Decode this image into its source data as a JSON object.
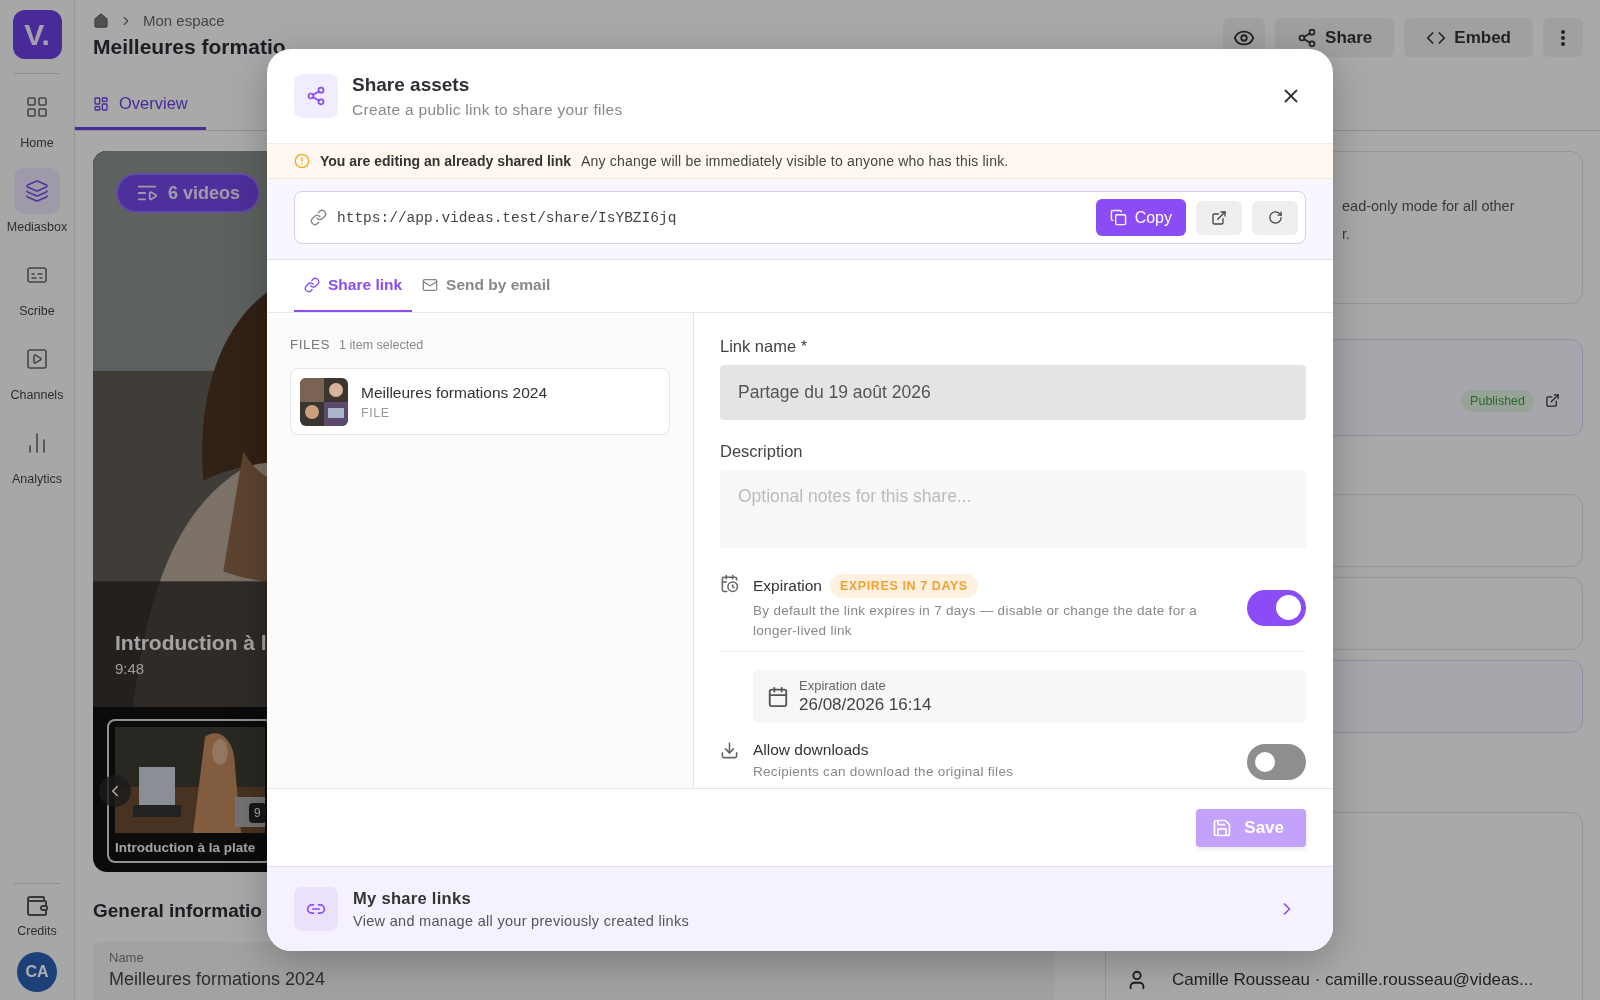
{
  "sidebar": {
    "logo": "V.",
    "items": [
      {
        "label": "Home",
        "kind": "home",
        "selected": false
      },
      {
        "label": "Mediasbox",
        "kind": "media",
        "selected": true
      },
      {
        "label": "Scribe",
        "kind": "scribe",
        "selected": false
      },
      {
        "label": "Channels",
        "kind": "channels",
        "selected": false
      },
      {
        "label": "Analytics",
        "kind": "analytics",
        "selected": false
      }
    ],
    "footer": {
      "label": "Credits"
    },
    "avatar": "CA"
  },
  "header": {
    "breadcrumb": "Mon espace",
    "title": "Meilleures formatio",
    "actions": [
      {
        "kind": "preview"
      },
      {
        "kind": "share",
        "label": "Share"
      },
      {
        "kind": "embed",
        "label": "Embed"
      },
      {
        "kind": "more"
      }
    ]
  },
  "tabs": [
    {
      "label": "Overview",
      "selected": true
    }
  ],
  "video_card": {
    "badge": "6 videos",
    "title": "Introduction à l",
    "duration": "9:48",
    "thumbnail": {
      "title": "Introduction à la plate",
      "duration": "9"
    }
  },
  "general_info": {
    "heading": "General informatio",
    "name_label": "Name",
    "name_value": "Meilleures formations 2024"
  },
  "details_panel": {
    "notice_lines": [
      "ead-only mode for all other",
      "r."
    ],
    "status": "Published",
    "owner": "Camille Rousseau · camille.rousseau@videas..."
  },
  "share_modal": {
    "title": "Share assets",
    "subtitle": "Create a public link to share your files",
    "notice": {
      "title": "You are editing an already shared link",
      "text": "Any change will be immediately visible to anyone who has this link."
    },
    "url": "https://app.videas.test/share/IsYBZI6jq",
    "copy_button": "Copy",
    "tabs": [
      {
        "label": "Share link",
        "kind": "link",
        "selected": true
      },
      {
        "label": "Send by email",
        "kind": "email",
        "selected": false
      }
    ],
    "files": {
      "heading": "FILES",
      "count": "1 item selected",
      "items": [
        {
          "name": "Meilleures formations 2024",
          "type": "FILE"
        }
      ]
    },
    "link_name": {
      "label": "Link name *",
      "value": "Partage du 19 août 2026"
    },
    "description": {
      "label": "Description",
      "placeholder": "Optional notes for this share..."
    },
    "expiration": {
      "title": "Expiration",
      "badge": "EXPIRES IN 7 DAYS",
      "text": "By default the link expires in 7 days — disable or change the date for a longer-lived link",
      "on": true,
      "date_label": "Expiration date",
      "date_value": "26/08/2026 16:14"
    },
    "downloads": {
      "title": "Allow downloads",
      "text": "Recipients can download the original files",
      "on": false
    },
    "save": {
      "label": "Save",
      "disabled": true
    },
    "my_links": {
      "title": "My share links",
      "text": "View and manage all your previously created links"
    }
  }
}
